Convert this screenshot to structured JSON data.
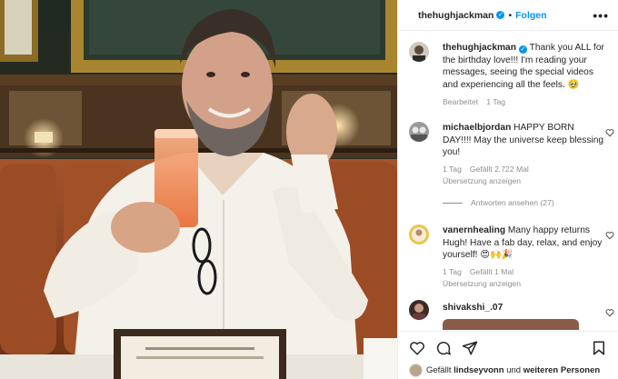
{
  "header": {
    "username": "thehughjackman",
    "verified_mark": "✓",
    "separator": "•",
    "follow_label": "Folgen",
    "more_icon": "more-horizontal-icon"
  },
  "caption": {
    "username": "thehughjackman",
    "text": "Thank you ALL for the birthday love!!! I'm reading your messages, seeing the special videos and experiencing all the feels. 🥹",
    "edited_label": "Bearbeitet",
    "time": "1 Tag"
  },
  "comments": [
    {
      "username": "michaelbjordan",
      "text": "HAPPY BORN DAY!!!! May the universe keep blessing you!",
      "time": "1 Tag",
      "likes": "Gefällt 2.722 Mal",
      "translate": "Übersetzung anzeigen",
      "replies": "Antworten ansehen (27)"
    },
    {
      "username": "vanernhealing",
      "text": "Many happy returns Hugh! Have a fab day, relax, and enjoy yourself! 😍🙌🎉",
      "time": "1 Tag",
      "likes": "Gefällt 1 Mal",
      "translate": "Übersetzung anzeigen"
    },
    {
      "username": "shivakshi_.07",
      "text": ""
    }
  ],
  "actions": {
    "like_icon": "heart-icon",
    "comment_icon": "comment-icon",
    "share_icon": "share-icon",
    "save_icon": "bookmark-icon"
  },
  "liked_by": {
    "prefix": "Gefällt",
    "user": "lindseyvonn",
    "connector": "und",
    "others": "weiteren Personen"
  },
  "colors": {
    "accent": "#0095f6",
    "muted": "#8e8e8e",
    "text": "#262626"
  }
}
